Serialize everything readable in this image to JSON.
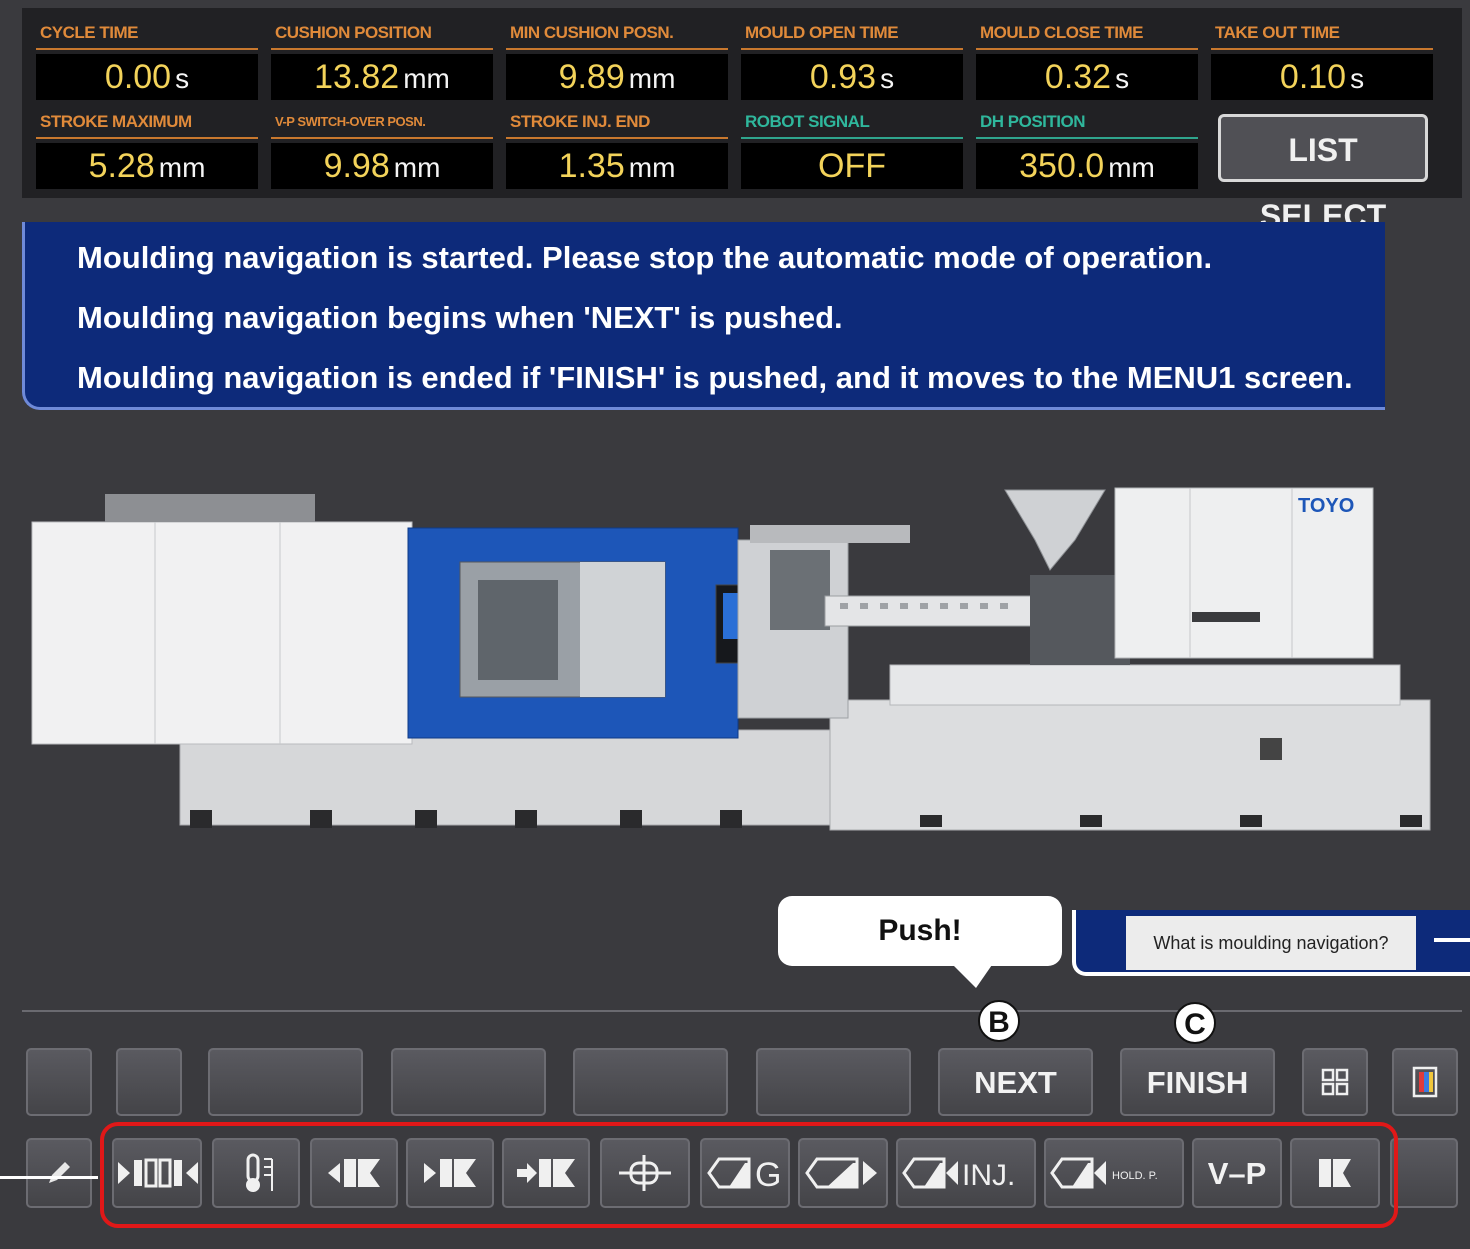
{
  "monitor": {
    "row1": [
      {
        "label": "CYCLE TIME",
        "value": "0.00",
        "unit": "s"
      },
      {
        "label": "CUSHION POSITION",
        "value": "13.82",
        "unit": "mm"
      },
      {
        "label": "MIN CUSHION POSN.",
        "value": "9.89",
        "unit": "mm"
      },
      {
        "label": "MOULD OPEN TIME",
        "value": "0.93",
        "unit": "s"
      },
      {
        "label": "MOULD CLOSE TIME",
        "value": "0.32",
        "unit": "s"
      },
      {
        "label": "TAKE OUT TIME",
        "value": "0.10",
        "unit": "s"
      }
    ],
    "row2": [
      {
        "label": "STROKE MAXIMUM",
        "value": "5.28",
        "unit": "mm"
      },
      {
        "label": "V-P SWITCH-OVER POSN.",
        "value": "9.98",
        "unit": "mm"
      },
      {
        "label": "STROKE INJ. END",
        "value": "1.35",
        "unit": "mm"
      },
      {
        "label": "ROBOT SIGNAL",
        "value": "OFF",
        "unit": ""
      },
      {
        "label": "DH POSITION",
        "value": "350.0",
        "unit": "mm"
      }
    ],
    "list_select_label": "LIST SELECT"
  },
  "banner": {
    "lines": [
      "Moulding navigation is started. Please stop the automatic mode of operation.",
      "Moulding navigation begins when 'NEXT' is pushed.",
      "Moulding navigation is ended if 'FINISH' is pushed, and it moves to the MENU1 screen."
    ]
  },
  "machine": {
    "brand": "TOYO"
  },
  "bubble": {
    "text": "Push!"
  },
  "help": {
    "text": "What is moulding navigation?"
  },
  "markers": {
    "b": "B",
    "c": "C"
  },
  "function_keys": {
    "next": "NEXT",
    "finish": "FINISH"
  },
  "tab_keys": [
    {
      "name": "mould-open-close-tab",
      "icon": "mould-icon"
    },
    {
      "name": "temperature-tab",
      "icon": "thermometer-icon"
    },
    {
      "name": "ejector-back-tab",
      "icon": "ejector-back-icon"
    },
    {
      "name": "ejector-forward-tab",
      "icon": "ejector-forward-icon"
    },
    {
      "name": "ejector-advance-tab",
      "icon": "ejector-advance-icon"
    },
    {
      "name": "nozzle-tab",
      "icon": "nozzle-icon"
    },
    {
      "name": "g-tab",
      "icon": "injection-g-icon",
      "label": "G"
    },
    {
      "name": "injection-unit-tab",
      "icon": "injection-unit-icon"
    },
    {
      "name": "injection-tab",
      "icon": "injection-icon",
      "label": "INJ."
    },
    {
      "name": "hold-pressure-tab",
      "icon": "hold-pressure-icon",
      "label": "HOLD. P."
    },
    {
      "name": "v-p-tab",
      "icon": "",
      "label": "V–P"
    },
    {
      "name": "charge-tab",
      "icon": "charge-icon"
    }
  ],
  "colors": {
    "banner": "#0d2a7a",
    "panel": "#212124",
    "value": "#f3d35a",
    "label_orange": "#e08a3a",
    "label_teal": "#2fb79c",
    "highlight": "#e01818",
    "machine_blue": "#1d56b8"
  }
}
